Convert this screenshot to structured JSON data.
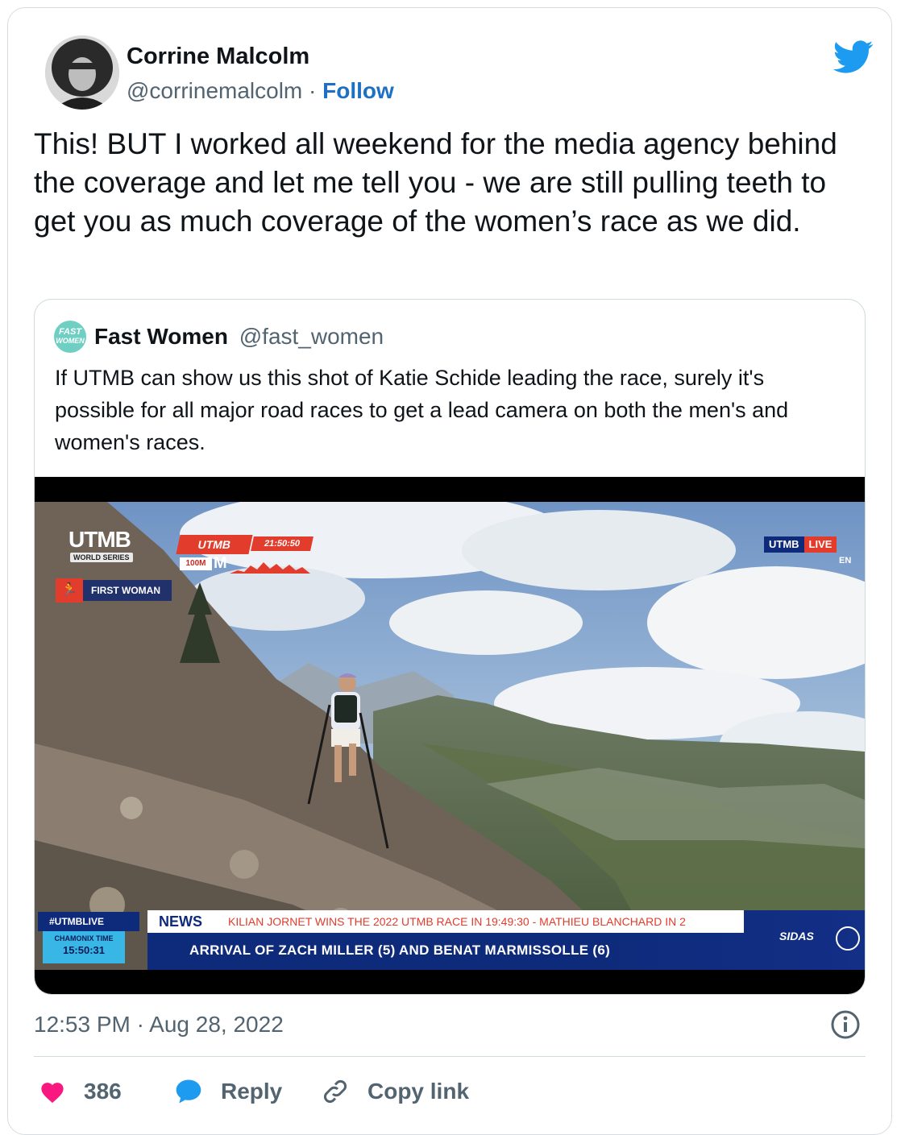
{
  "author": {
    "name": "Corrine Malcolm",
    "handle": "@corrinemalcolm",
    "separator": "·",
    "follow_label": "Follow"
  },
  "tweet": {
    "text": "This! BUT I worked all weekend for the media agency behind the coverage and let me tell you - we are still pulling teeth to get you as much coverage of the women’s race as we did."
  },
  "quoted": {
    "avatar_text_1": "FAST",
    "avatar_text_2": "WOMEN",
    "name": "Fast Women",
    "handle": "@fast_women",
    "text": "If UTMB can show us this shot of Katie Schide leading the race, surely it's possible for all major road races to get a lead camera on both the men's and women's races.",
    "video": {
      "logo": "UTMB",
      "logo_sub": "WORLD SERIES",
      "race_name": "UTMB",
      "race_time": "21:50:50",
      "race_distance": "100M",
      "race_letter": "M",
      "first_label": "FIRST WOMAN",
      "live_brand": "UTMB",
      "live_label": "LIVE",
      "live_lang": "EN",
      "hashtag": "#UTMBLIVE",
      "clock_label": "CHAMONIX TIME",
      "clock_time": "15:50:31",
      "news_label": "NEWS",
      "ticker": "KILIAN JORNET WINS THE 2022 UTMB RACE IN 19:49:30 - MATHIEU BLANCHARD IN 2",
      "headline": "ARRIVAL OF ZACH MILLER (5) AND BENAT MARMISSOLLE (6)",
      "sponsor": "SIDAS"
    }
  },
  "meta": {
    "timestamp": "12:53 PM · Aug 28, 2022"
  },
  "actions": {
    "likes": "386",
    "reply_label": "Reply",
    "copy_label": "Copy link"
  },
  "colors": {
    "accent": "#1d9bf0",
    "follow": "#1d70c2",
    "heart": "#f91880",
    "utmb_red": "#e23c2c",
    "utmb_blue": "#0e2a7a"
  },
  "icons": [
    "twitter-bird-icon",
    "info-icon",
    "heart-icon",
    "reply-bubble-icon",
    "link-icon"
  ]
}
